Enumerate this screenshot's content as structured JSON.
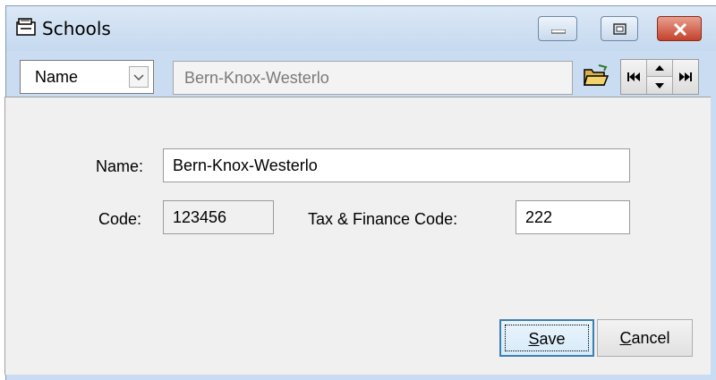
{
  "window": {
    "title": "Schools",
    "icon": "folder-cabinet-icon"
  },
  "toolbar": {
    "field_select": "Name",
    "search_value": "Bern-Knox-Westerlo",
    "icons": [
      "open-folder-icon",
      "first-record-icon",
      "previous-record-icon",
      "next-record-icon",
      "last-record-icon"
    ]
  },
  "form": {
    "name_label": "Name:",
    "name_value": "Bern-Knox-Westerlo",
    "code_label": "Code:",
    "code_value": "123456",
    "tax_label": "Tax & Finance Code:",
    "tax_value": "222"
  },
  "buttons": {
    "save_mnemonic": "S",
    "save_rest": "ave",
    "cancel_mnemonic": "C",
    "cancel_rest": "ancel"
  },
  "colors": {
    "title_bar": "#c9dcf1",
    "close_button": "#c4422b",
    "default_button_border": "#3c7fb1"
  }
}
